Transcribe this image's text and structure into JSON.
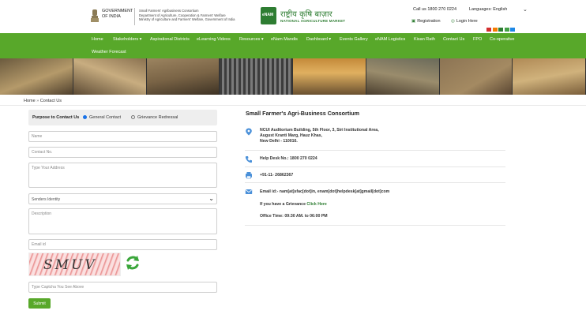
{
  "header": {
    "gov_line1": "GOVERNMENT",
    "gov_line2": "OF INDIA",
    "dept_line1": "Small Farmers' Agribusiness Consortium",
    "dept_line2": "Department of Agriculture, Cooperation & Farmers' Welfare",
    "dept_line3": "Ministry of Agriculture and Farmers' Welfare, Government of India",
    "enam_badge": "eNAM",
    "enam_hindi": "राष्ट्रीय कृषि बाज़ार",
    "enam_english": "NATIONAL AGRICULTURE MARKET",
    "call": "Call us 1800 270 0224",
    "language_label": "Languages: English",
    "registration": "Registration",
    "login": "Login Here",
    "theme_colors": [
      "#d32f2f",
      "#f57c00",
      "#2e7d32",
      "#43a047",
      "#1e88e5"
    ]
  },
  "nav": {
    "items": [
      "Home",
      "Stakeholders ▾",
      "Aspirational Districts",
      "eLearning Videos",
      "Resources ▾",
      "eNam Mandis",
      "Dashboard ▾",
      "Events Gallery",
      "eNAM Logistics",
      "Kisan Rath",
      "Contact Us",
      "FPO",
      "Co-operative"
    ],
    "second_row": "Weather Forecast",
    "accent": "#58a82a"
  },
  "breadcrumb": {
    "home": "Home",
    "sep": "»",
    "current": "Contact Us"
  },
  "form": {
    "purpose_label": "Purpose to Contact Us",
    "option_general": "General Contact",
    "option_grievance": "Grievance Redressal",
    "name_placeholder": "Name",
    "contact_placeholder": "Contact No.",
    "address_placeholder": "Type Your Address",
    "identity_selected": "Senders Identity",
    "description_placeholder": "Description",
    "email_placeholder": "Email id",
    "captcha_text": "SMUV",
    "captcha_input_placeholder": "Type Captcha You See Above",
    "submit_label": "Submit"
  },
  "contact": {
    "org": "Small Farmer's Agri-Business Consortium",
    "address_line1": "NCUI Auditorium Building, 5th Floor, 3, Siri Institutional Area,",
    "address_line2": "August Kranti Marg, Hauz Khas,",
    "address_line3": "New Delhi - 110016.",
    "helpdesk": "Help Desk No.: 1800 270 0224",
    "fax": "+91-11- 26862367",
    "email": "Email id:- nam[at]sfac[dot]in, enam[dot]helpdesk[at]gmail[dot]com",
    "grievance_prefix": "If you have a Grievance",
    "click_here": "Click Here",
    "office_time": "Office Time: 09:30 AM. to 06:00 PM"
  }
}
